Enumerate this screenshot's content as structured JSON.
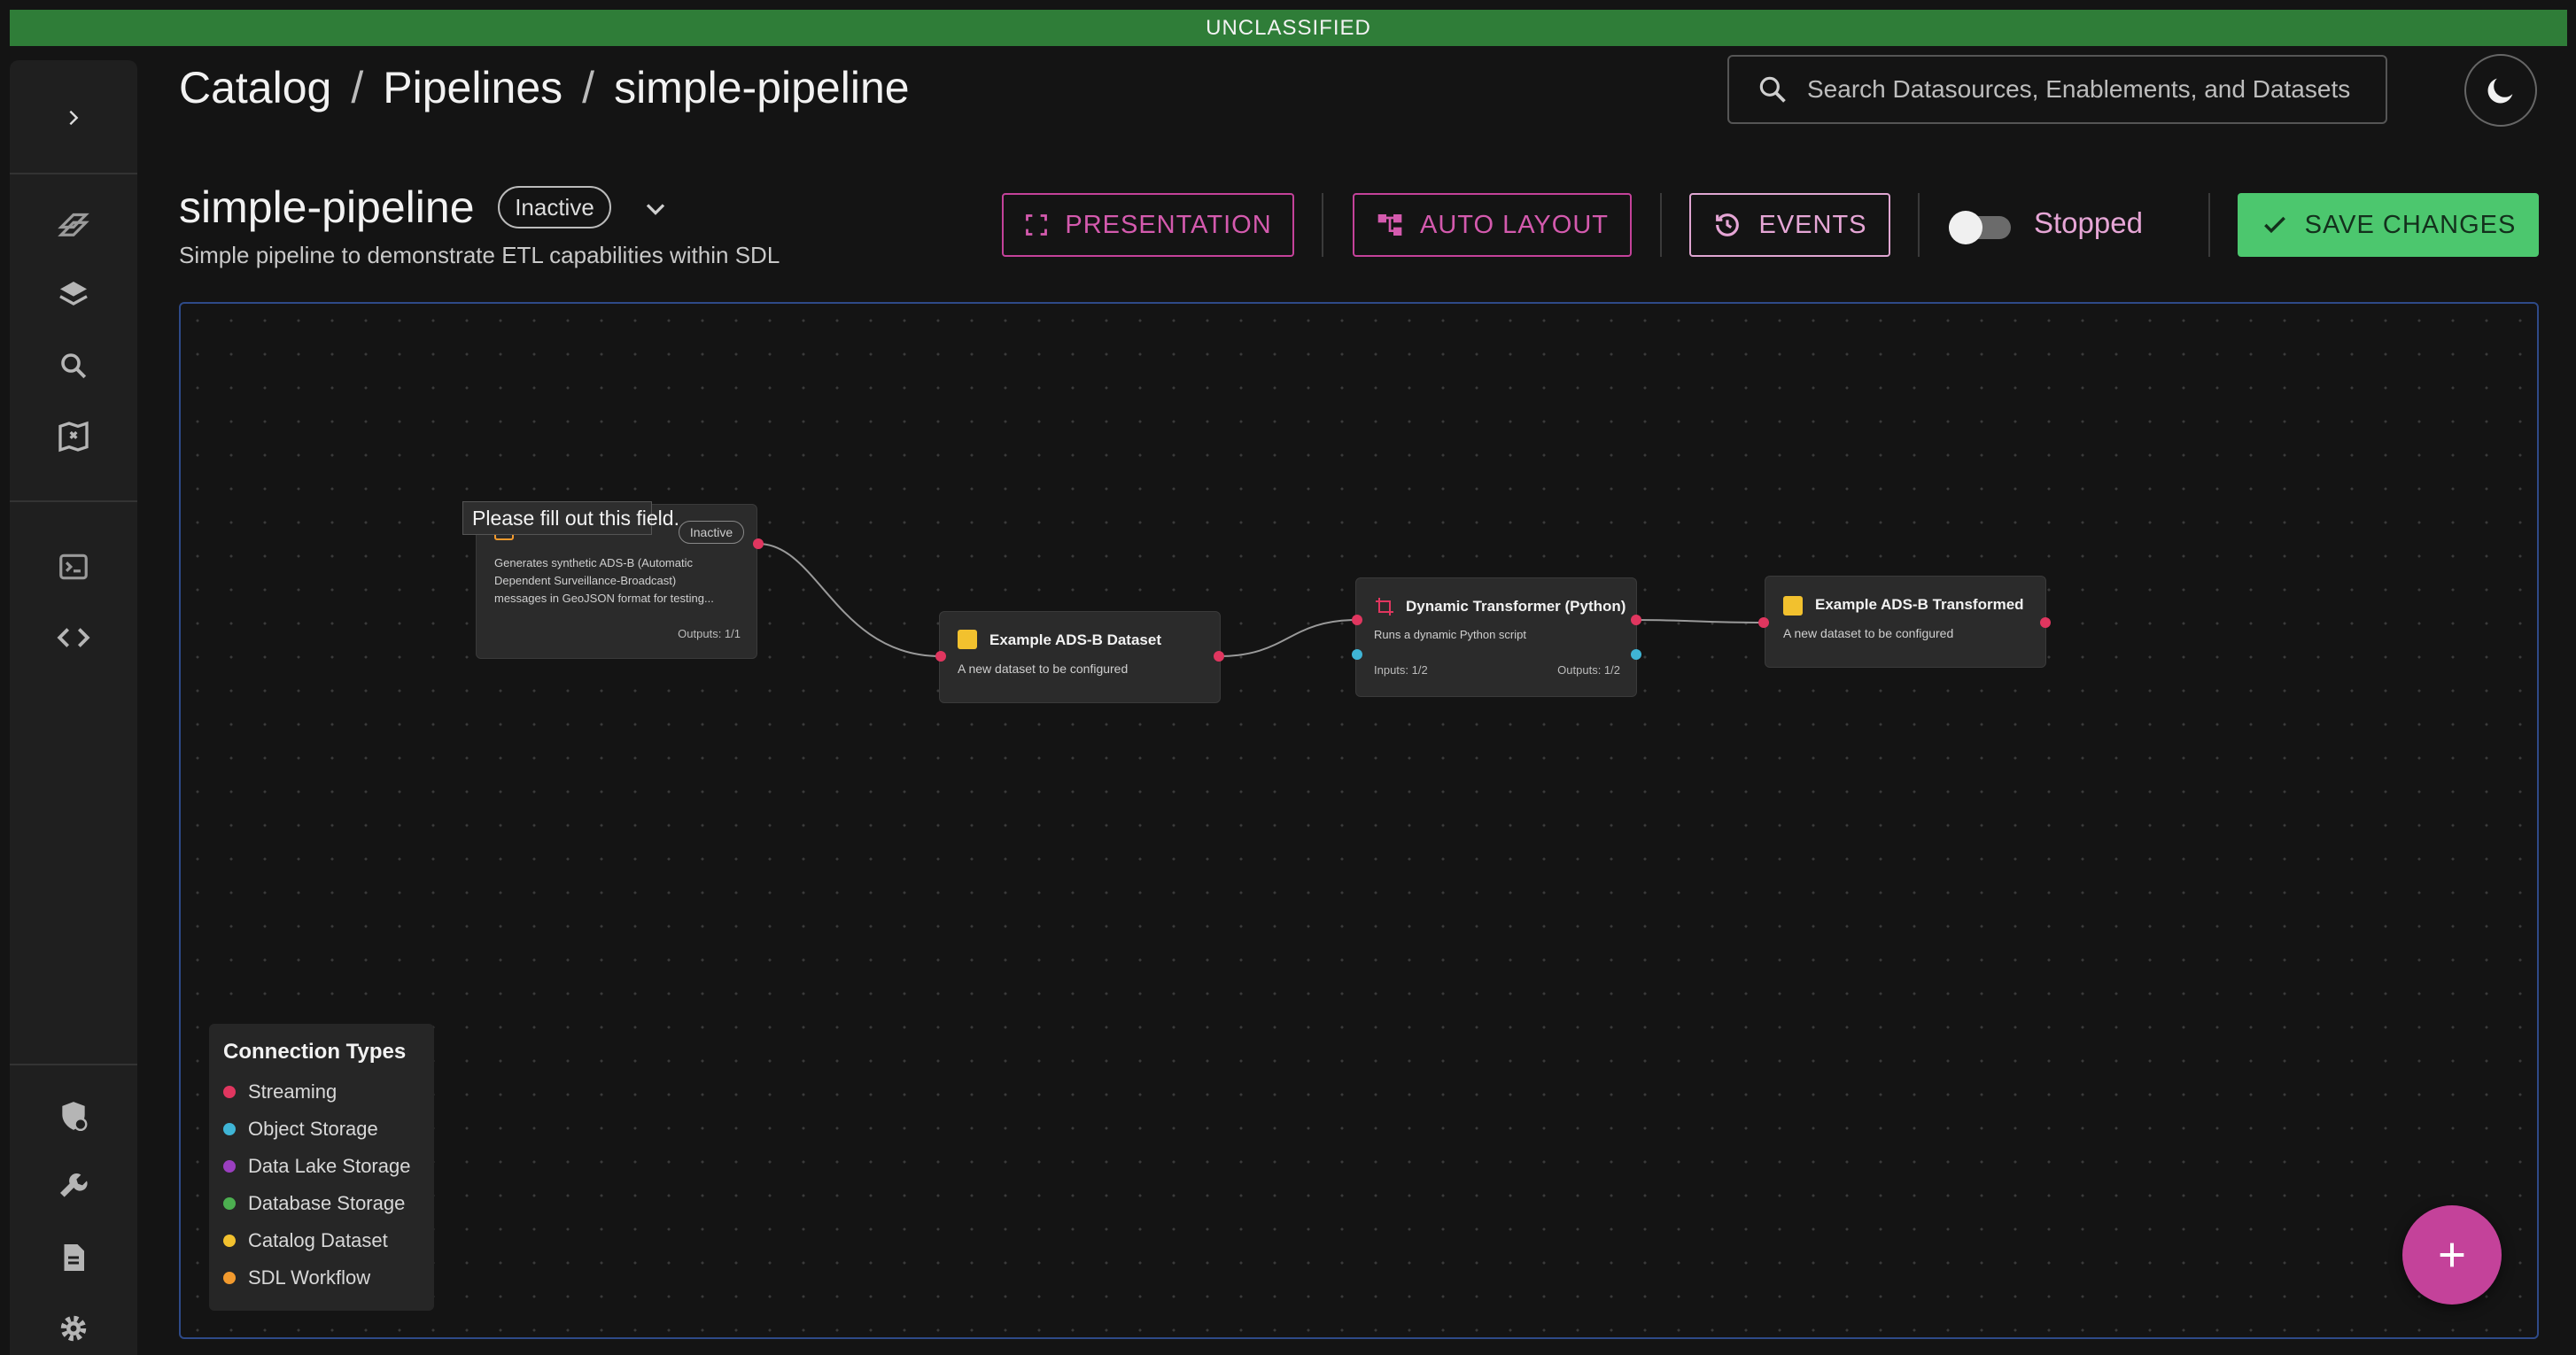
{
  "banner": {
    "text": "UNCLASSIFIED",
    "color": "#2f7d38"
  },
  "sidebar": {
    "items": [
      {
        "icon": "chevron-right-icon"
      },
      {
        "icon": "pipelines-icon"
      },
      {
        "icon": "layers-icon"
      },
      {
        "icon": "search-icon"
      },
      {
        "icon": "map-icon"
      },
      {
        "icon": "terminal-icon"
      },
      {
        "icon": "code-icon"
      },
      {
        "icon": "shield-icon"
      },
      {
        "icon": "wrench-icon"
      },
      {
        "icon": "document-icon"
      },
      {
        "icon": "gear-icon"
      }
    ]
  },
  "breadcrumb": {
    "items": [
      "Catalog",
      "Pipelines",
      "simple-pipeline"
    ],
    "separator": "/"
  },
  "search": {
    "placeholder": "Search Datasources, Enablements, and Datasets"
  },
  "theme_toggle": {
    "icon": "moon-icon"
  },
  "pipeline": {
    "name": "simple-pipeline",
    "status": "Inactive",
    "description": "Simple pipeline to demonstrate ETL capabilities within SDL"
  },
  "toolbar": {
    "presentation_label": "PRESENTATION",
    "auto_layout_label": "AUTO LAYOUT",
    "events_label": "EVENTS",
    "run_state_label": "Stopped",
    "run_state_on": false,
    "save_label": "SAVE CHANGES",
    "accent_color": "#c4429a",
    "save_color": "#4cc76e"
  },
  "nodes": {
    "source": {
      "status": "Inactive",
      "description_lines": [
        "Generates synthetic ADS-B (Automatic",
        "Dependent Surveillance-Broadcast)",
        "messages in GeoJSON format for testing..."
      ],
      "outputs": "Outputs: 1/1"
    },
    "dataset": {
      "title": "Example ADS-B Dataset",
      "description": "A new dataset to be configured"
    },
    "transformer": {
      "title": "Dynamic Transformer (Python)",
      "description": "Runs a dynamic Python script",
      "inputs": "Inputs: 1/2",
      "outputs": "Outputs: 1/2"
    },
    "transformed": {
      "title": "Example ADS-B Transformed",
      "description": "A new dataset to be configured"
    }
  },
  "tooltip": {
    "text": "Please fill out this field."
  },
  "legend": {
    "title": "Connection Types",
    "items": [
      {
        "label": "Streaming",
        "color": "#e0365f"
      },
      {
        "label": "Object Storage",
        "color": "#3fb5d6"
      },
      {
        "label": "Data Lake Storage",
        "color": "#9b3fc0"
      },
      {
        "label": "Database Storage",
        "color": "#4caf50"
      },
      {
        "label": "Catalog Dataset",
        "color": "#f2c12e"
      },
      {
        "label": "SDL Workflow",
        "color": "#f29a2e"
      }
    ]
  },
  "fab": {
    "icon": "plus-icon"
  }
}
